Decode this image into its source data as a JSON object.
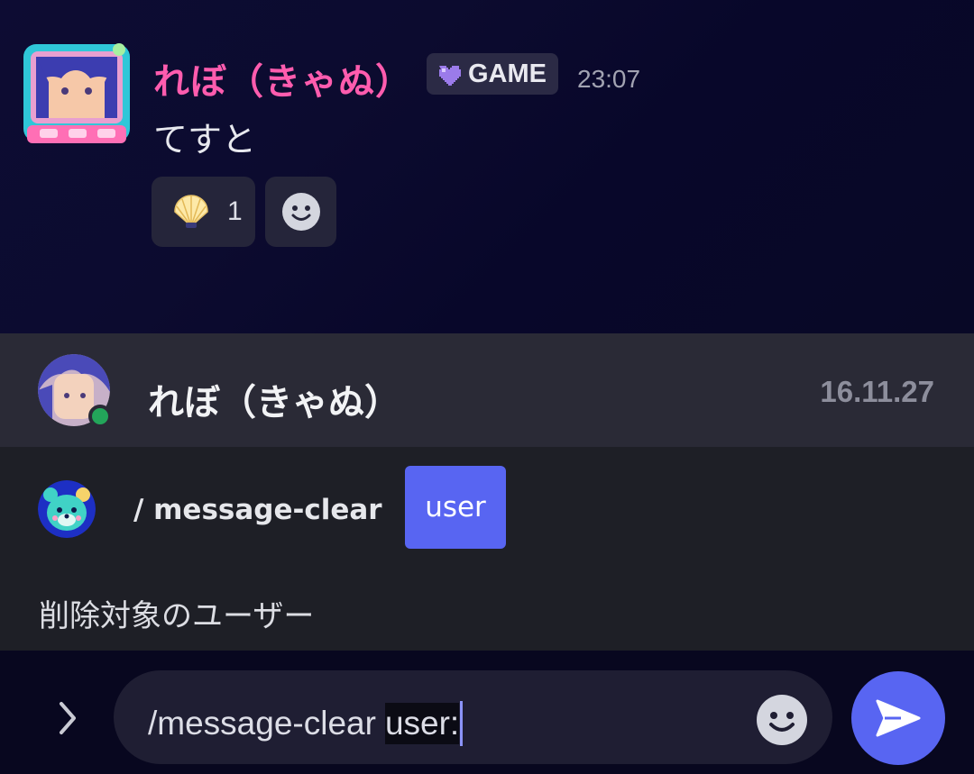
{
  "message": {
    "author": "れぼ（きゃぬ）",
    "role_tag": "GAME",
    "time": "23:07",
    "content": "てすと",
    "reactions": [
      {
        "emoji": "shell-icon",
        "count": "1"
      }
    ]
  },
  "autocomplete": {
    "user_name": "れぼ（きゃぬ）",
    "user_date": "16.11.27",
    "command": "/ message-clear",
    "option_chip": "user",
    "option_description": "削除対象のユーザー"
  },
  "input": {
    "command_text": "/message-clear",
    "option_text": "user:"
  },
  "colors": {
    "accent": "#5865f2",
    "username": "#ff5cae",
    "online": "#23a55a"
  }
}
